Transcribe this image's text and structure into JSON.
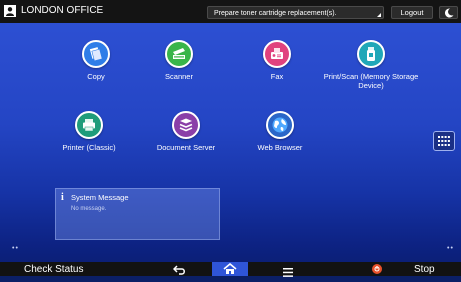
{
  "topbar": {
    "office_name": "LONDON OFFICE",
    "status_message": "Prepare toner cartridge replacement(s).",
    "logout_label": "Logout"
  },
  "apps": [
    {
      "label": "Copy",
      "icon": "copy-icon",
      "color": "#2f7de8"
    },
    {
      "label": "Scanner",
      "icon": "scanner-icon",
      "color": "#39b54a"
    },
    {
      "label": "Fax",
      "icon": "fax-icon",
      "color": "#e0427e"
    },
    {
      "label": "Print/Scan (Memory Storage Device)",
      "icon": "memory-storage-icon",
      "color": "#20a7b8"
    },
    {
      "label": "Printer (Classic)",
      "icon": "printer-icon",
      "color": "#1f9c7a"
    },
    {
      "label": "Document Server",
      "icon": "document-server-icon",
      "color": "#8a3fa8"
    },
    {
      "label": "Web Browser",
      "icon": "globe-icon",
      "color": "#2a66c8"
    }
  ],
  "system_message": {
    "title": "System Message",
    "body": "No message."
  },
  "bottombar": {
    "check_status_label": "Check Status",
    "stop_label": "Stop"
  },
  "colors": {
    "background": "#2445c4",
    "bar": "#141414",
    "home_active": "#2f55d8",
    "stop": "#e8502a"
  }
}
